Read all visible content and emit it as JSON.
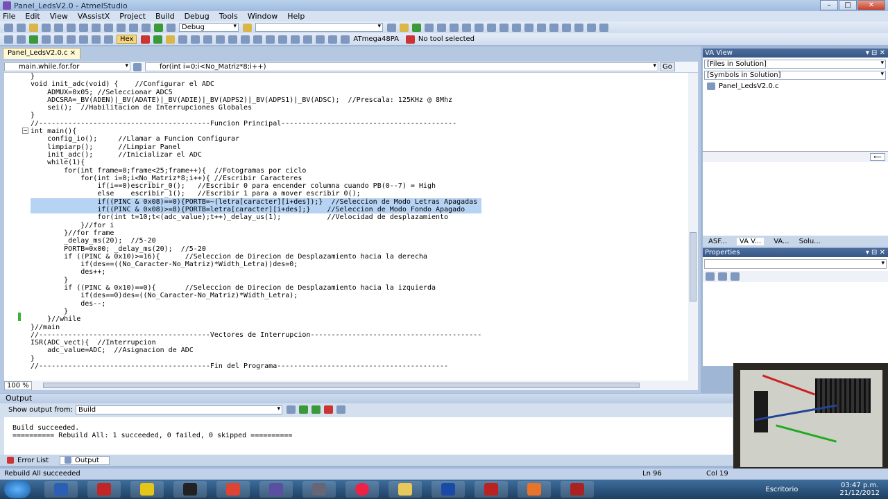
{
  "window": {
    "title": "Panel_LedsV2.0 - AtmelStudio"
  },
  "menu": [
    "File",
    "Edit",
    "View",
    "VAssistX",
    "Project",
    "Build",
    "Debug",
    "Tools",
    "Window",
    "Help"
  ],
  "toolbar": {
    "config": "Debug",
    "hex_label": "Hex",
    "device": "ATmega48PA",
    "tool": "No tool selected"
  },
  "editor": {
    "tab_label": "Panel_LedsV2.0.c",
    "nav_left": "main.while.for.for",
    "nav_right": "for(int i=0;i<No_Matriz*8;i++)",
    "go_label": "Go",
    "zoom": "100 %",
    "lines": [
      "}",
      "void init_adc(void) {    //Configurar el ADC",
      "    ADMUX=0x05; //Seleccionar ADC5",
      "    ADCSRA=_BV(ADEN)|_BV(ADATE)|_BV(ADIE)|_BV(ADPS2)|_BV(ADPS1)|_BV(ADSC);  //Prescala: 125KHz @ 8Mhz",
      "    sei();  //Habilitacion de Interrupciones Globales",
      "}",
      "//-----------------------------------------Funcion Principal------------------------------------------",
      "int main(){",
      "    config_io();     //Llamar a Funcion Configurar",
      "    limpiarp();      //Limpiar Panel",
      "    init_adc();      //Inicializar el ADC",
      "    while(1){",
      "        for(int frame=0;frame<25;frame++){  //Fotogramas por ciclo",
      "            for(int i=0;i<No_Matriz*8;i++){ //Escribir Caracteres",
      "                if(i==0)escribir_0();   //Escribir 0 para encender columna cuando PB(0--7) = High",
      "                else    escribir_1();   //Escribir 1 para a mover escribir 0();",
      "                if((PINC & 0x08)==0){PORTB=~(letra[caracter][i+des]);}  //Seleccion de Modo Letras Apagadas",
      "                if((PINC & 0x08)>=8){PORTB=letra[caracter][i+des];}    //Seleccion de Modo Fondo Apagado",
      "                for(int t=10;t<(adc_value);t++)_delay_us(1);           //Velocidad de desplazamiento",
      "            }//for i",
      "        }//for frame",
      "        _delay_ms(20);  //5-20",
      "        PORTB=0x00; _delay_ms(20);  //5-20",
      "        if ((PINC & 0x10)>=16){      //Seleccion de Direcion de Desplazamiento hacia la derecha",
      "            if(des==((No_Caracter-No_Matriz)*Width_Letra))des=0;",
      "            des++;",
      "        }",
      "        if ((PINC & 0x10)==0){       //Seleccion de Direcion de Desplazamiento hacia la izquierda",
      "            if(des==0)des=((No_Caracter-No_Matriz)*Width_Letra);",
      "            des--;",
      "        }",
      "    }//while",
      "}//main",
      "//-----------------------------------------Vectores de Interrupcion-----------------------------------------",
      "ISR(ADC_vect){  //Interrupcion",
      "    adc_value=ADC;  //Asignacion de ADC",
      "}",
      "//-----------------------------------------Fin del Programa-----------------------------------------"
    ]
  },
  "va_view": {
    "title": "VA View",
    "files_dd": "[Files in Solution]",
    "symbols_dd": "[Symbols in Solution]",
    "file": "Panel_LedsV2.0.c",
    "tabs": [
      "ASF...",
      "VA V...",
      "VA...",
      "Solu..."
    ]
  },
  "properties": {
    "title": "Properties"
  },
  "output": {
    "title": "Output",
    "show_from_label": "Show output from:",
    "source": "Build",
    "text": "Build succeeded.\n========== Rebuild All: 1 succeeded, 0 failed, 0 skipped =========="
  },
  "bottom_tabs": {
    "error_list": "Error List",
    "output": "Output"
  },
  "status": {
    "message": "Rebuild All succeeded",
    "ln": "Ln 96",
    "col": "Col 19"
  },
  "taskbar": {
    "desktop": "Escritorio",
    "time": "03:47 p.m.",
    "date": "21/12/2012"
  }
}
